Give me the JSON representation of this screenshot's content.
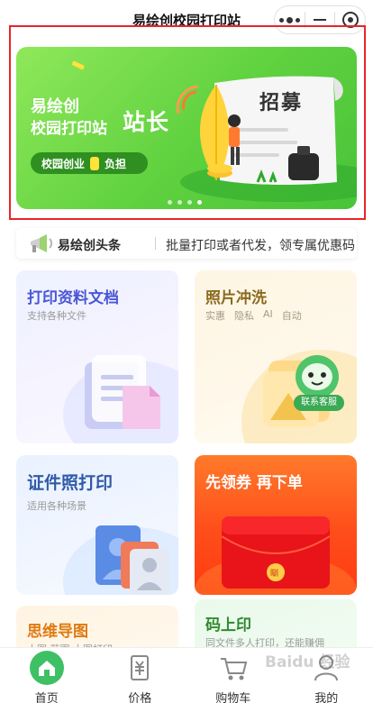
{
  "header": {
    "title": "易绘创校园打印站"
  },
  "banner": {
    "brand_line1": "易绘创",
    "brand_line2": "校园打印站",
    "role": "站长",
    "pill_left": "校园创业",
    "pill_right": "负担",
    "recruit": "招募",
    "page_count": 4,
    "active_page": 4
  },
  "news": {
    "title": "易绘创头条",
    "text": "批量打印或者代发，领专属优惠码"
  },
  "cards": {
    "print_docs": {
      "title": "打印资料文档",
      "subtitle": "支持各种文件"
    },
    "photo": {
      "title": "照片冲洗",
      "tags": [
        "实惠",
        "隐私",
        "AI",
        "自动"
      ],
      "service_label": "联系客服"
    },
    "id_photo": {
      "title": "证件照打印",
      "subtitle": "适用各种场景"
    },
    "coupon": {
      "title": "先领券 再下单",
      "coin_label": "瞓"
    },
    "mindmap": {
      "title": "思维导图",
      "subtitle": "大图 范围 大图打印"
    },
    "code_print": {
      "title": "码上印",
      "subtitle": "同文件多人打印，还能赚佣"
    }
  },
  "tabbar": {
    "items": [
      {
        "label": "首页",
        "active": true
      },
      {
        "label": "价格",
        "active": false
      },
      {
        "label": "购物车",
        "active": false
      },
      {
        "label": "我的",
        "active": false
      }
    ]
  },
  "watermark": "Baidu 经验",
  "colors": {
    "banner_green": "#5fd13f",
    "pill_green": "#2f8f20",
    "frame_red": "#e8252a",
    "doc_title_blue": "#4a56d6",
    "photo_title_brown": "#8a6a1e",
    "id_title_blue": "#2f5aa8",
    "coupon_orange": "#ff5a1f",
    "mindmap_orange": "#e07a12",
    "code_green": "#2f8a2f",
    "tab_active_green": "#3ec064"
  }
}
